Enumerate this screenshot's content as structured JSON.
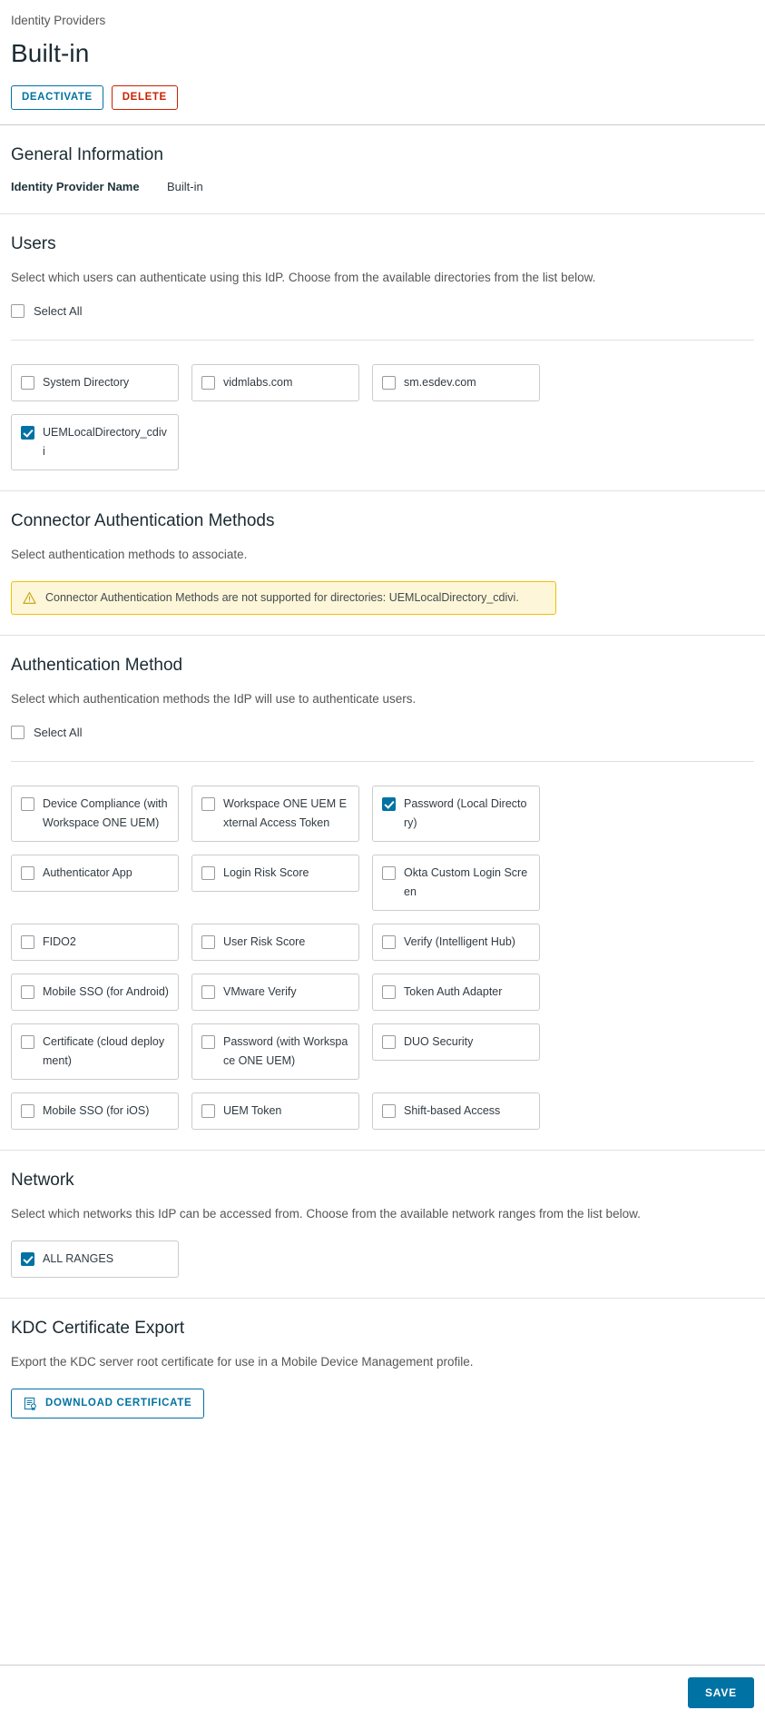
{
  "header": {
    "breadcrumb": "Identity Providers",
    "title": "Built-in",
    "deactivate_label": "DEACTIVATE",
    "delete_label": "DELETE"
  },
  "general": {
    "title": "General Information",
    "name_label": "Identity Provider Name",
    "name_value": "Built-in"
  },
  "users": {
    "title": "Users",
    "description": "Select which users can authenticate using this IdP. Choose from the available directories from the list below.",
    "select_all_label": "Select All",
    "select_all_checked": false,
    "directories": [
      {
        "label": "System Directory",
        "checked": false
      },
      {
        "label": "vidmlabs.com",
        "checked": false
      },
      {
        "label": "sm.esdev.com",
        "checked": false
      },
      {
        "label": "UEMLocalDirectory_cdivi",
        "checked": true
      }
    ]
  },
  "connector_auth": {
    "title": "Connector Authentication Methods",
    "description": "Select authentication methods to associate.",
    "warning": "Connector Authentication Methods are not supported for directories: UEMLocalDirectory_cdivi.",
    "warning_icon": "warning-triangle-icon"
  },
  "auth_method": {
    "title": "Authentication Method",
    "description": "Select which authentication methods the IdP will use to authenticate users.",
    "select_all_label": "Select All",
    "select_all_checked": false,
    "methods": [
      {
        "label": "Device Compliance (with Workspace ONE UEM)",
        "checked": false,
        "tall": true
      },
      {
        "label": "Workspace ONE UEM External Access Token",
        "checked": false,
        "tall": true
      },
      {
        "label": "Password (Local Directory)",
        "checked": true,
        "tall": false
      },
      {
        "label": "Authenticator App",
        "checked": false,
        "tall": false
      },
      {
        "label": "Login Risk Score",
        "checked": false,
        "tall": false
      },
      {
        "label": "Okta Custom Login Screen",
        "checked": false,
        "tall": false
      },
      {
        "label": "FIDO2",
        "checked": false,
        "tall": false
      },
      {
        "label": "User Risk Score",
        "checked": false,
        "tall": false
      },
      {
        "label": "Verify (Intelligent Hub)",
        "checked": false,
        "tall": false
      },
      {
        "label": "Mobile SSO (for Android)",
        "checked": false,
        "tall": false
      },
      {
        "label": "VMware Verify",
        "checked": false,
        "tall": false
      },
      {
        "label": "Token Auth Adapter",
        "checked": false,
        "tall": false
      },
      {
        "label": "Certificate (cloud deployment)",
        "checked": false,
        "tall": true
      },
      {
        "label": "Password (with Workspace ONE UEM)",
        "checked": false,
        "tall": true
      },
      {
        "label": "DUO Security",
        "checked": false,
        "tall": false
      },
      {
        "label": "Mobile SSO (for iOS)",
        "checked": false,
        "tall": false
      },
      {
        "label": "UEM Token",
        "checked": false,
        "tall": false
      },
      {
        "label": "Shift-based Access",
        "checked": false,
        "tall": false
      }
    ]
  },
  "network": {
    "title": "Network",
    "description": "Select which networks this IdP can be accessed from. Choose from the available network ranges from the list below.",
    "ranges": [
      {
        "label": "ALL RANGES",
        "checked": true
      }
    ]
  },
  "kdc": {
    "title": "KDC Certificate Export",
    "description": "Export the KDC server root certificate for use in a Mobile Device Management profile.",
    "download_label": "DOWNLOAD CERTIFICATE",
    "download_icon": "certificate-icon"
  },
  "footer": {
    "save_label": "SAVE"
  },
  "colors": {
    "accent": "#0072a3",
    "danger": "#c92100",
    "warning_bg": "#fdf6d8",
    "warning_border": "#efc006"
  }
}
